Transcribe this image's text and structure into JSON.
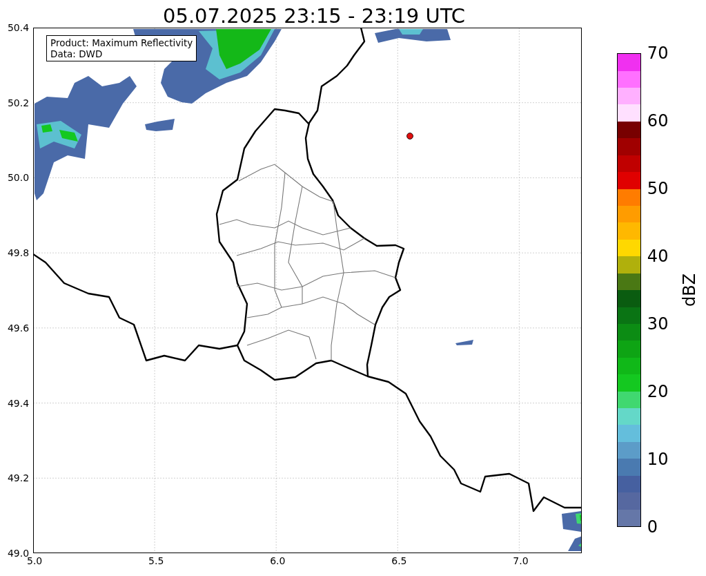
{
  "title": "05.07.2025 23:15 - 23:19 UTC",
  "info_box": {
    "lines": [
      "Product: Maximum Reflectivity",
      "Data: DWD"
    ]
  },
  "x_ticks": [
    "5.0",
    "5.5",
    "6.0",
    "6.5",
    "7.0"
  ],
  "y_ticks": [
    "50.4",
    "50.2",
    "50.0",
    "49.8",
    "49.6",
    "49.4",
    "49.2",
    "49.0"
  ],
  "colorbar": {
    "label": "dBZ",
    "ticks": [
      "70",
      "60",
      "50",
      "40",
      "30",
      "20",
      "10",
      "0"
    ],
    "steps": [
      {
        "color": "#6577a8"
      },
      {
        "color": "#5668a0"
      },
      {
        "color": "#4660a0"
      },
      {
        "color": "#4a7ab0"
      },
      {
        "color": "#5c9cc8"
      },
      {
        "color": "#64bedc"
      },
      {
        "color": "#64d8c8"
      },
      {
        "color": "#40d870"
      },
      {
        "color": "#14c820"
      },
      {
        "color": "#10b818"
      },
      {
        "color": "#0ea414"
      },
      {
        "color": "#0c8c14"
      },
      {
        "color": "#0a7414"
      },
      {
        "color": "#0a5c10"
      },
      {
        "color": "#4a7814"
      },
      {
        "color": "#b0b00c"
      },
      {
        "color": "#ffd800"
      },
      {
        "color": "#ffb800"
      },
      {
        "color": "#ff9c00"
      },
      {
        "color": "#ff7c00"
      },
      {
        "color": "#e00000"
      },
      {
        "color": "#c00000"
      },
      {
        "color": "#a00000"
      },
      {
        "color": "#780000"
      },
      {
        "color": "#ffe0ff"
      },
      {
        "color": "#ffb0ff"
      },
      {
        "color": "#ff70ff"
      },
      {
        "color": "#f030f0"
      }
    ]
  }
}
